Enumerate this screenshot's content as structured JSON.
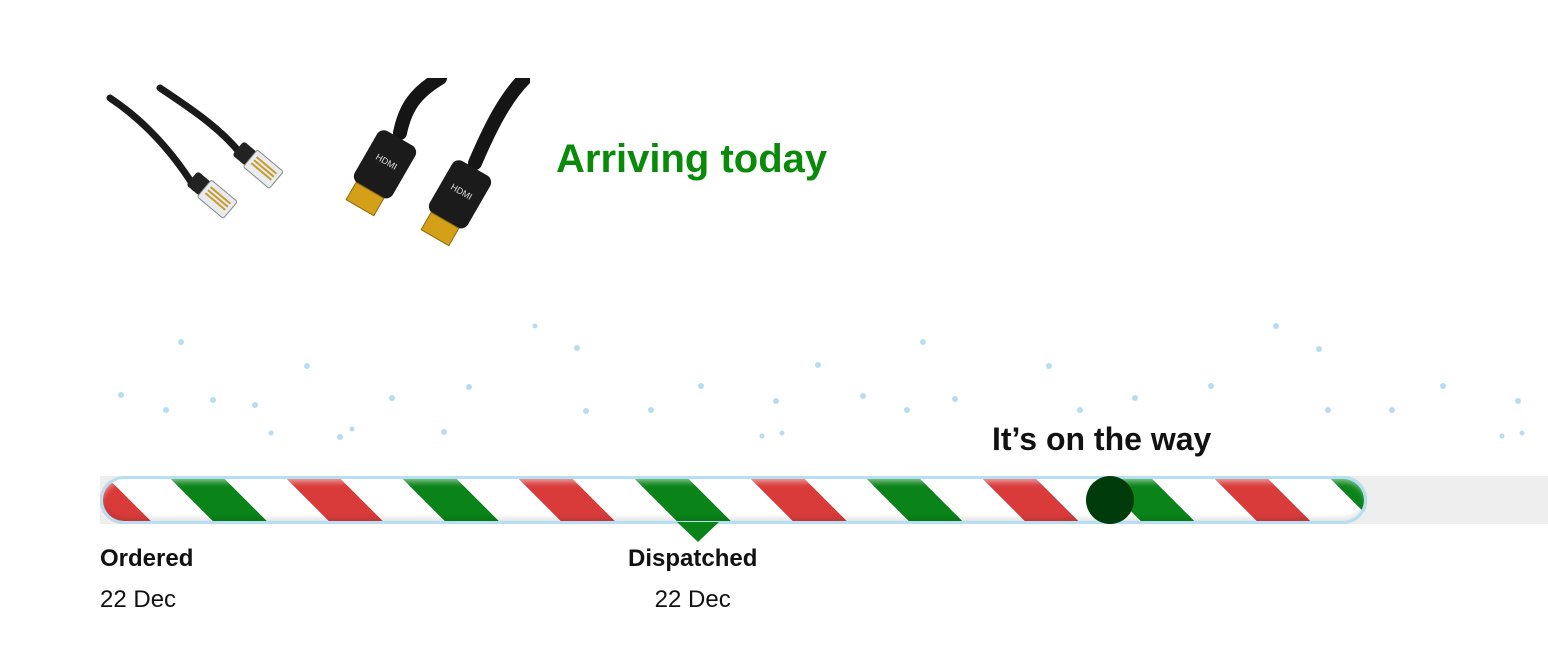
{
  "header": {
    "title_fragment": ""
  },
  "shipment": {
    "status": "Arriving today",
    "status_color": "#0a8a0a",
    "product_images": [
      {
        "icon": "ethernet-cable-image"
      },
      {
        "icon": "hdmi-cable-image"
      }
    ]
  },
  "progress": {
    "message": "It’s on the way",
    "fraction": 0.78,
    "steps": [
      {
        "label": "Ordered",
        "date": "22 Dec"
      },
      {
        "label": "Dispatched",
        "date": "22 Dec"
      }
    ],
    "colors": {
      "red": "#d93b3b",
      "green": "#0a8419",
      "marker": "#003b0c",
      "track": "#eeeeee"
    }
  }
}
